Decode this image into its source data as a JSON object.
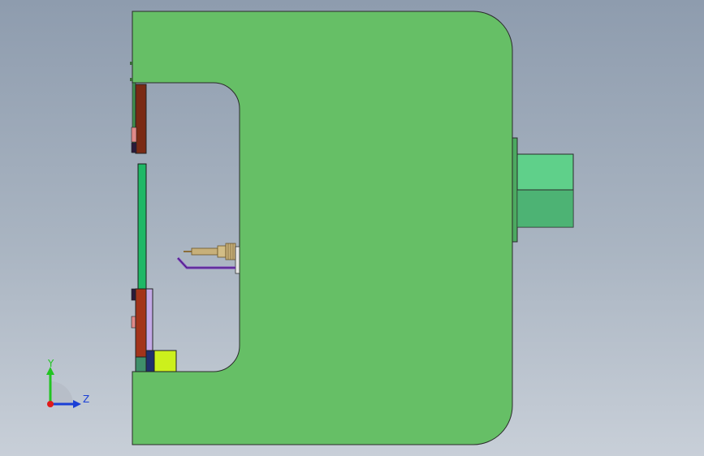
{
  "viewport": {
    "background_top": "#8e9cae",
    "background_bottom": "#c8cfd8"
  },
  "colors": {
    "frame_green": "#66bf66",
    "cylinder_green": "#5fd08a",
    "cylinder_dark": "#3e9a62",
    "plate_brown": "#7a2a14",
    "plate_pink": "#e08a8a",
    "plate_lavender": "#c3a9e6",
    "block_yellow": "#ccf01c",
    "block_navy": "#1f2f6e",
    "strip_green": "#1fb866",
    "gold_part": "#c7b07a",
    "purple_part": "#7b3bbf"
  },
  "triad": {
    "y_label": "Y",
    "z_label": "Z",
    "y_color": "#22c422",
    "z_color": "#1a3fd6",
    "origin_color": "#e01a1a"
  }
}
